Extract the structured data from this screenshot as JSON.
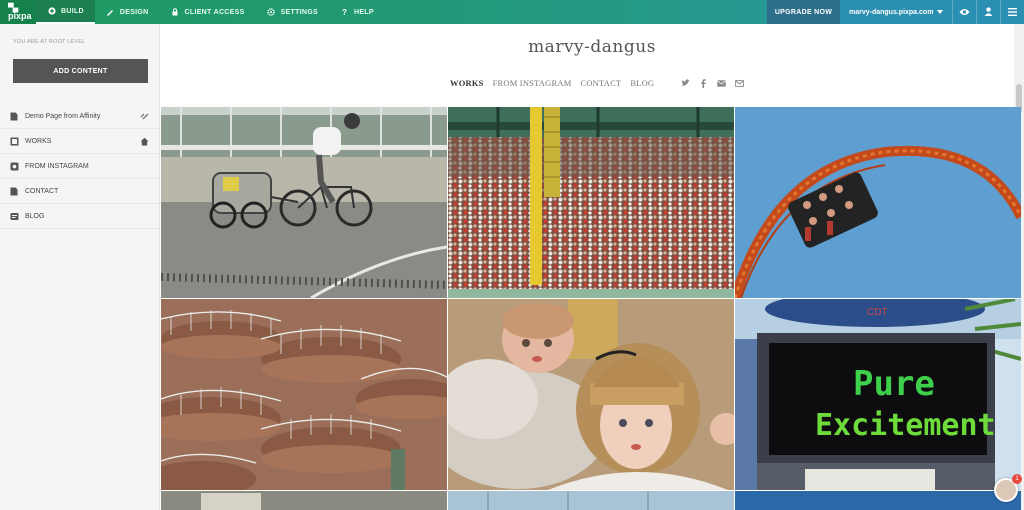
{
  "topbar": {
    "logo_text": "pixpa",
    "tabs": [
      {
        "label": "BUILD",
        "icon": "plus-circle-icon"
      },
      {
        "label": "DESIGN",
        "icon": "brush-icon"
      },
      {
        "label": "CLIENT ACCESS",
        "icon": "lock-icon"
      },
      {
        "label": "SETTINGS",
        "icon": "gear-icon"
      },
      {
        "label": "HELP",
        "icon": "question-icon"
      }
    ],
    "upgrade_label": "UPGRADE NOW",
    "site_domain": "marvy-dangus.pixpa.com",
    "colors": {
      "bar_start": "#1f9a5e",
      "bar_end": "#2a9aa6",
      "upgrade": "#2d6f8a"
    }
  },
  "sidebar": {
    "root_label": "YOU ARE AT ROOT LEVEL",
    "add_button": "ADD CONTENT",
    "items": [
      {
        "label": "Demo Page from Affinity",
        "icon": "page-icon",
        "tail": "link-icon"
      },
      {
        "label": "WORKS",
        "icon": "gallery-icon",
        "tail": "home-icon"
      },
      {
        "label": "FROM INSTAGRAM",
        "icon": "instagram-icon",
        "tail": ""
      },
      {
        "label": "CONTACT",
        "icon": "page-icon",
        "tail": ""
      },
      {
        "label": "BLOG",
        "icon": "blog-icon",
        "tail": ""
      }
    ]
  },
  "site": {
    "title": "marvy-dangus",
    "nav": [
      "WORKS",
      "FROM INSTAGRAM",
      "CONTACT",
      "BLOG"
    ],
    "social_icons": [
      "twitter-icon",
      "facebook-icon",
      "email-icon",
      "envelope-icon"
    ],
    "tile_overlays": {
      "sign_line1": "Pure",
      "sign_line2": "Excitement"
    }
  },
  "chat": {
    "badge_count": "1"
  }
}
